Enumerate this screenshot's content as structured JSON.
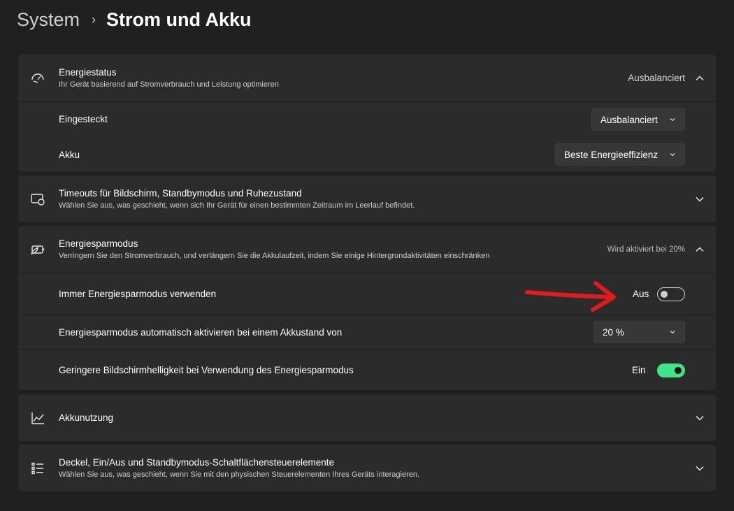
{
  "breadcrumb": {
    "parent": "System",
    "separator": "›",
    "current": "Strom und Akku"
  },
  "power_mode": {
    "title": "Energiestatus",
    "subtitle": "Ihr Gerät basierend auf Stromverbrauch und Leistung optimieren",
    "value": "Ausbalanciert",
    "plugged_in": {
      "label": "Eingesteckt",
      "value": "Ausbalanciert"
    },
    "battery": {
      "label": "Akku",
      "value": "Beste Energieeffizienz"
    }
  },
  "timeouts": {
    "title": "Timeouts für Bildschirm, Standbymodus und Ruhezustand",
    "subtitle": "Wählen Sie aus, was geschieht, wenn sich Ihr Gerät für einen bestimmten Zeitraum im Leerlauf befindet."
  },
  "saver": {
    "title": "Energiesparmodus",
    "subtitle": "Verringern Sie den Stromverbrauch, und verlängern Sie die Akkulaufzeit, indem Sie einige Hintergrundaktivitäten einschränken",
    "status": "Wird aktiviert bei 20%",
    "always": {
      "label": "Immer Energiesparmodus verwenden",
      "state": "Aus",
      "on": false
    },
    "auto": {
      "label": "Energiesparmodus automatisch aktivieren bei einem Akkustand von",
      "value": "20 %"
    },
    "brightness": {
      "label": "Geringere Bildschirmhelligkeit bei Verwendung des Energiesparmodus",
      "state": "Ein",
      "on": true
    }
  },
  "battery_usage": {
    "title": "Akkunutzung"
  },
  "lid": {
    "title": "Deckel, Ein/Aus und Standbymodus-Schaltflächensteuerelemente",
    "subtitle": "Wählen Sie aus, was geschieht, wenn Sie mit den physischen Steuerelementen Ihres Geräts interagieren."
  },
  "colors": {
    "background": "#202020",
    "card": "#2b2b2b",
    "accent": "#3ee58a",
    "annotation": "#e01b1b"
  },
  "icons": [
    "gauge-icon",
    "screen-moon-icon",
    "battery-leaf-icon",
    "chart-icon",
    "list-icon",
    "chevron-up-icon",
    "chevron-down-icon"
  ]
}
